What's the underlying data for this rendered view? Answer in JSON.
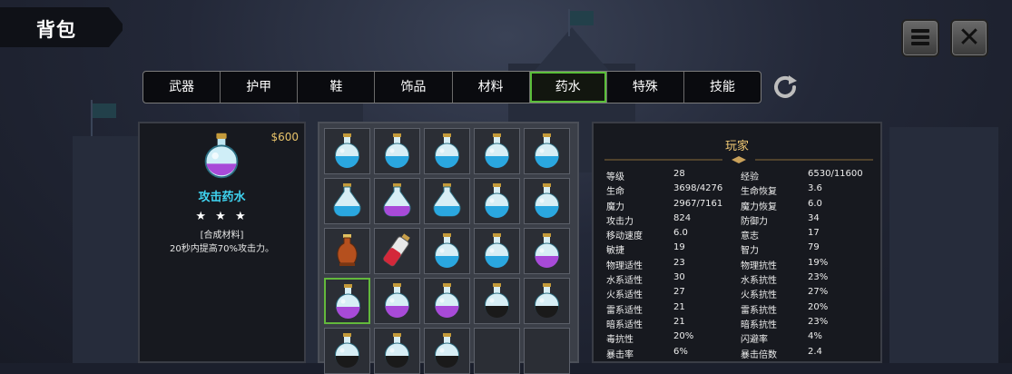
{
  "title": "背包",
  "tabs": [
    "武器",
    "护甲",
    "鞋",
    "饰品",
    "材料",
    "药水",
    "特殊",
    "技能"
  ],
  "active_tab": 5,
  "selected_item": {
    "price": "$600",
    "name": "攻击药水",
    "stars": "★ ★ ★",
    "type": "[合成材料]",
    "description": "20秒内提高70%攻击力。"
  },
  "inventory": [
    "blue",
    "blue",
    "blue",
    "blue",
    "blue",
    "blue-flask",
    "purple-flask",
    "blue-flask",
    "blue",
    "blue",
    "orange-vase",
    "red-bottle",
    "blue",
    "blue",
    "purple",
    "purple",
    "purple",
    "purple",
    "black",
    "black",
    "black",
    "black",
    "black",
    "empty",
    "empty"
  ],
  "selected_slot": 15,
  "player": {
    "title": "玩家",
    "stats": [
      [
        "等级",
        "28",
        "经验",
        "6530/11600"
      ],
      [
        "生命",
        "3698/4276",
        "生命恢复",
        "3.6"
      ],
      [
        "魔力",
        "2967/7161",
        "魔力恢复",
        "6.0"
      ],
      [
        "攻击力",
        "824",
        "防御力",
        "34"
      ],
      [
        "移动速度",
        "6.0",
        "意志",
        "17"
      ],
      [
        "敏捷",
        "19",
        "智力",
        "79"
      ],
      [
        "物理适性",
        "23",
        "物理抗性",
        "19%"
      ],
      [
        "水系适性",
        "30",
        "水系抗性",
        "23%"
      ],
      [
        "火系适性",
        "27",
        "火系抗性",
        "27%"
      ],
      [
        "雷系适性",
        "21",
        "雷系抗性",
        "20%"
      ],
      [
        "暗系适性",
        "21",
        "暗系抗性",
        "23%"
      ],
      [
        "毒抗性",
        "20%",
        "闪避率",
        "4%"
      ],
      [
        "暴击率",
        "6%",
        "暴击倍数",
        "2.4"
      ]
    ]
  },
  "icons": {
    "menu": "menu-icon",
    "close": "close-icon",
    "refresh": "refresh-icon"
  },
  "colors": {
    "active_tab_border": "#5bbf3a",
    "item_name": "#3fd3f0",
    "price": "#e8c36a",
    "player_title": "#f0c874",
    "potion_blue": "#2aa7e0",
    "potion_purple": "#a84ad8",
    "potion_black": "#1a1a1a"
  }
}
